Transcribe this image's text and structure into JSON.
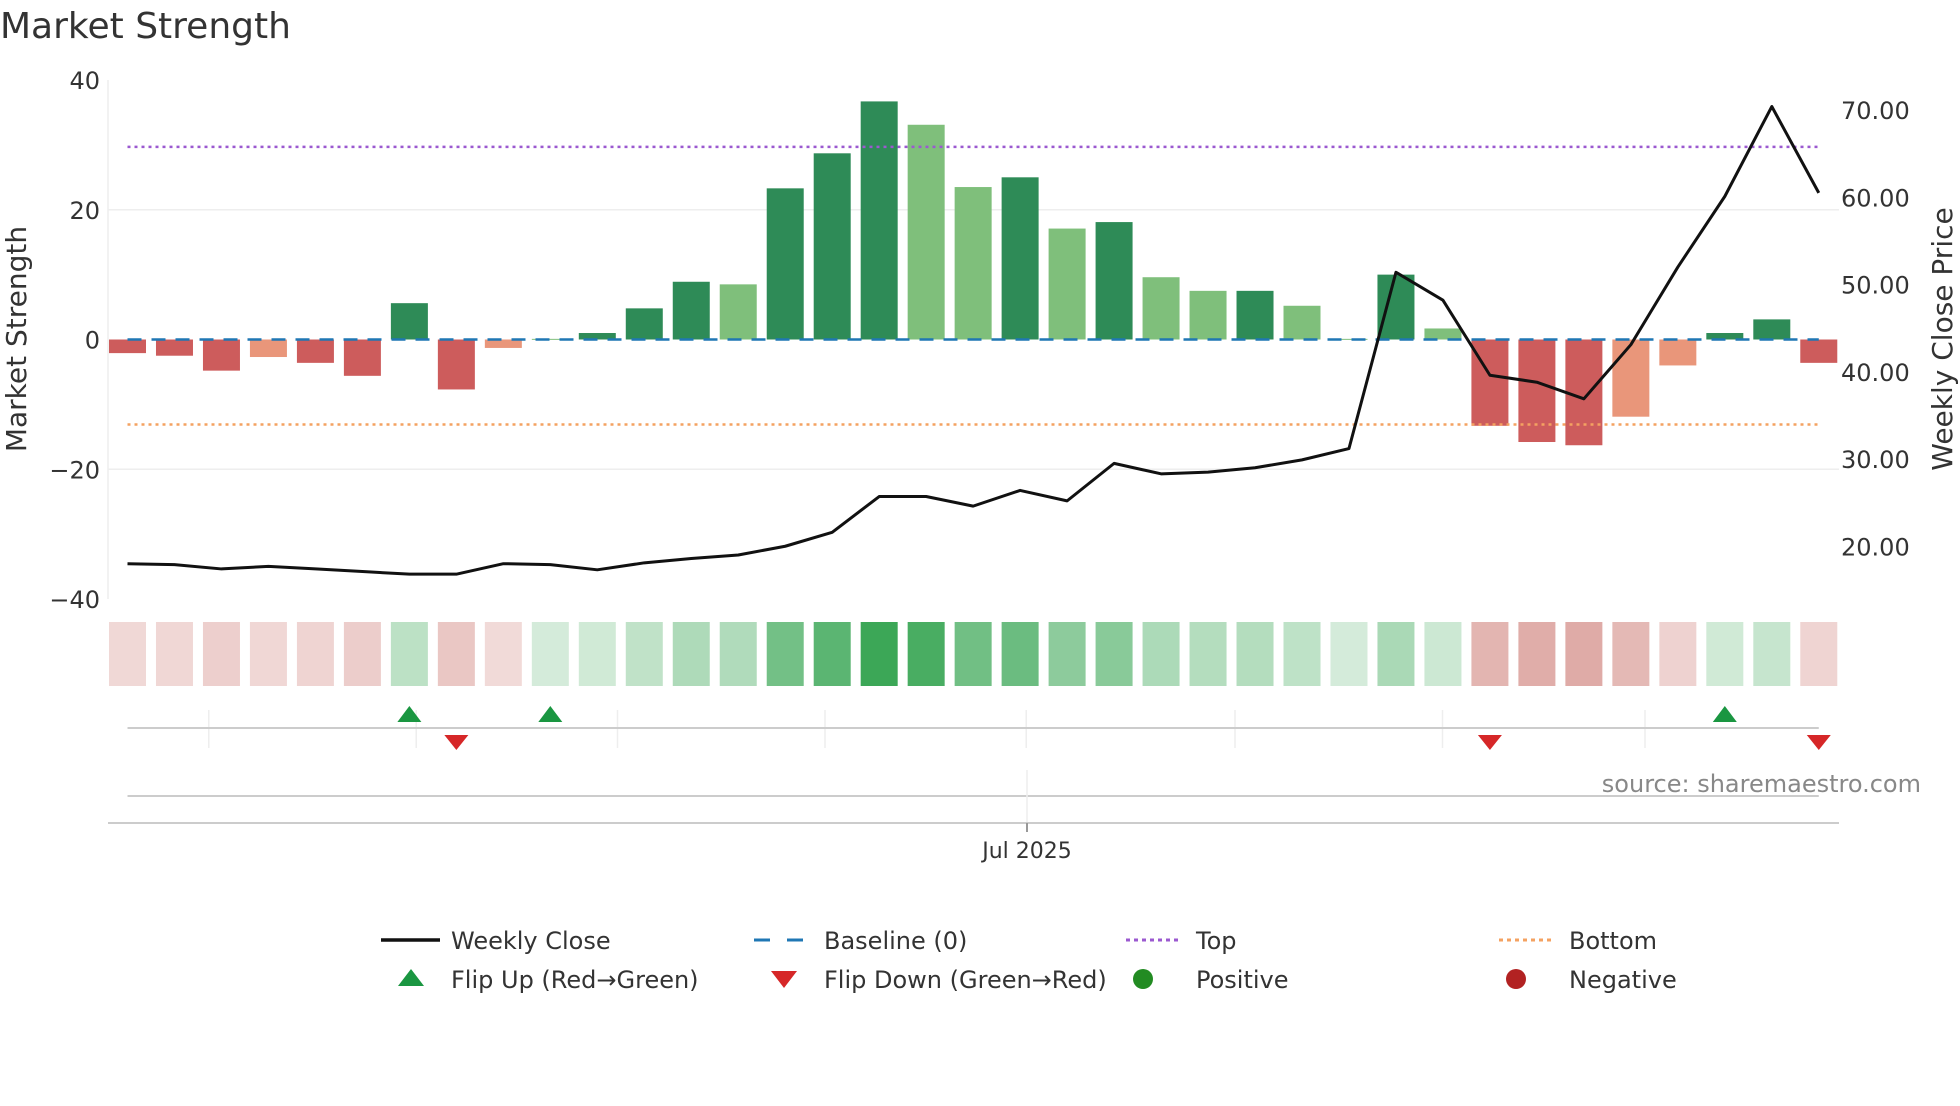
{
  "chart_data": {
    "type": "bar",
    "title": "Market Strength",
    "ylabel": "Market Strength",
    "y2label": "Weekly Close Price",
    "ylim": [
      -40,
      40
    ],
    "y2lim": [
      13.7,
      73.4
    ],
    "yticks": [
      "40",
      "20",
      "0",
      "−20",
      "−40"
    ],
    "ytick_values": [
      40,
      20,
      0,
      -20,
      -40
    ],
    "y2ticks": [
      "70.00",
      "60.00",
      "50.00",
      "40.00",
      "30.00",
      "20.00"
    ],
    "y2tick_values": [
      70,
      60,
      50,
      40,
      30,
      20
    ],
    "xtick_label": "Jul 2025",
    "xtick_index": 19,
    "top_level": 29.7,
    "bottom_level": -13.1,
    "baseline": 0,
    "strength": [
      -2.1,
      -2.5,
      -4.8,
      -2.7,
      -3.6,
      -5.6,
      5.6,
      -7.7,
      -1.3,
      0.1,
      1.0,
      4.8,
      8.9,
      8.5,
      23.3,
      28.7,
      36.7,
      33.1,
      23.5,
      25.0,
      17.1,
      18.1,
      9.6,
      7.5,
      7.5,
      5.2,
      0.1,
      10.0,
      1.7,
      -13.3,
      -15.8,
      -16.3,
      -11.9,
      -4.0,
      1.0,
      3.1,
      -3.6
    ],
    "bar_shade": [
      "strong",
      "strong",
      "strong",
      "weak",
      "strong",
      "strong",
      "strong",
      "strong",
      "weak",
      "weak",
      "strong",
      "strong",
      "strong",
      "weak",
      "strong",
      "strong",
      "strong",
      "weak",
      "weak",
      "strong",
      "weak",
      "strong",
      "weak",
      "weak",
      "strong",
      "weak",
      "weak",
      "strong",
      "weak",
      "strong",
      "strong",
      "strong",
      "weak",
      "weak",
      "strong",
      "strong",
      "strong"
    ],
    "weekly_close": [
      18.0,
      17.9,
      17.4,
      17.7,
      17.4,
      17.1,
      16.8,
      16.8,
      18.0,
      17.9,
      17.3,
      18.1,
      18.6,
      19.0,
      20.0,
      21.6,
      25.7,
      25.7,
      24.6,
      26.4,
      25.2,
      29.5,
      28.3,
      28.5,
      29.0,
      29.9,
      31.2,
      51.4,
      48.2,
      39.6,
      38.8,
      36.9,
      43.1,
      52.0,
      60.1,
      70.4,
      60.5
    ],
    "flip_up_indices": [
      6,
      9,
      34
    ],
    "flip_down_indices": [
      7,
      29,
      36
    ],
    "legend": [
      {
        "label": "Weekly Close",
        "symbol": "line-solid"
      },
      {
        "label": "Baseline (0)",
        "symbol": "line-dashed"
      },
      {
        "label": "Top",
        "symbol": "line-dotted-purple"
      },
      {
        "label": "Bottom",
        "symbol": "line-dotted-orange"
      },
      {
        "label": "Flip Up (Red→Green)",
        "symbol": "triangle-up"
      },
      {
        "label": "Flip Down (Green→Red)",
        "symbol": "triangle-down"
      },
      {
        "label": "Positive",
        "symbol": "circle-green"
      },
      {
        "label": "Negative",
        "symbol": "circle-red"
      }
    ],
    "legend_position": "bottom",
    "source": "source: sharemaestro.com"
  },
  "colors": {
    "pos_strong": "#2e8b57",
    "pos_weak": "#7fbf7b",
    "neg_strong": "#cd5c5c",
    "neg_weak": "#e9967a",
    "top": "#9b59d0",
    "bottom": "#f4a261",
    "baseline": "#1f77b4",
    "close": "#111111",
    "flip_up": "#1a9641",
    "flip_down": "#d62728",
    "positive": "#228b22",
    "negative": "#b22222"
  }
}
